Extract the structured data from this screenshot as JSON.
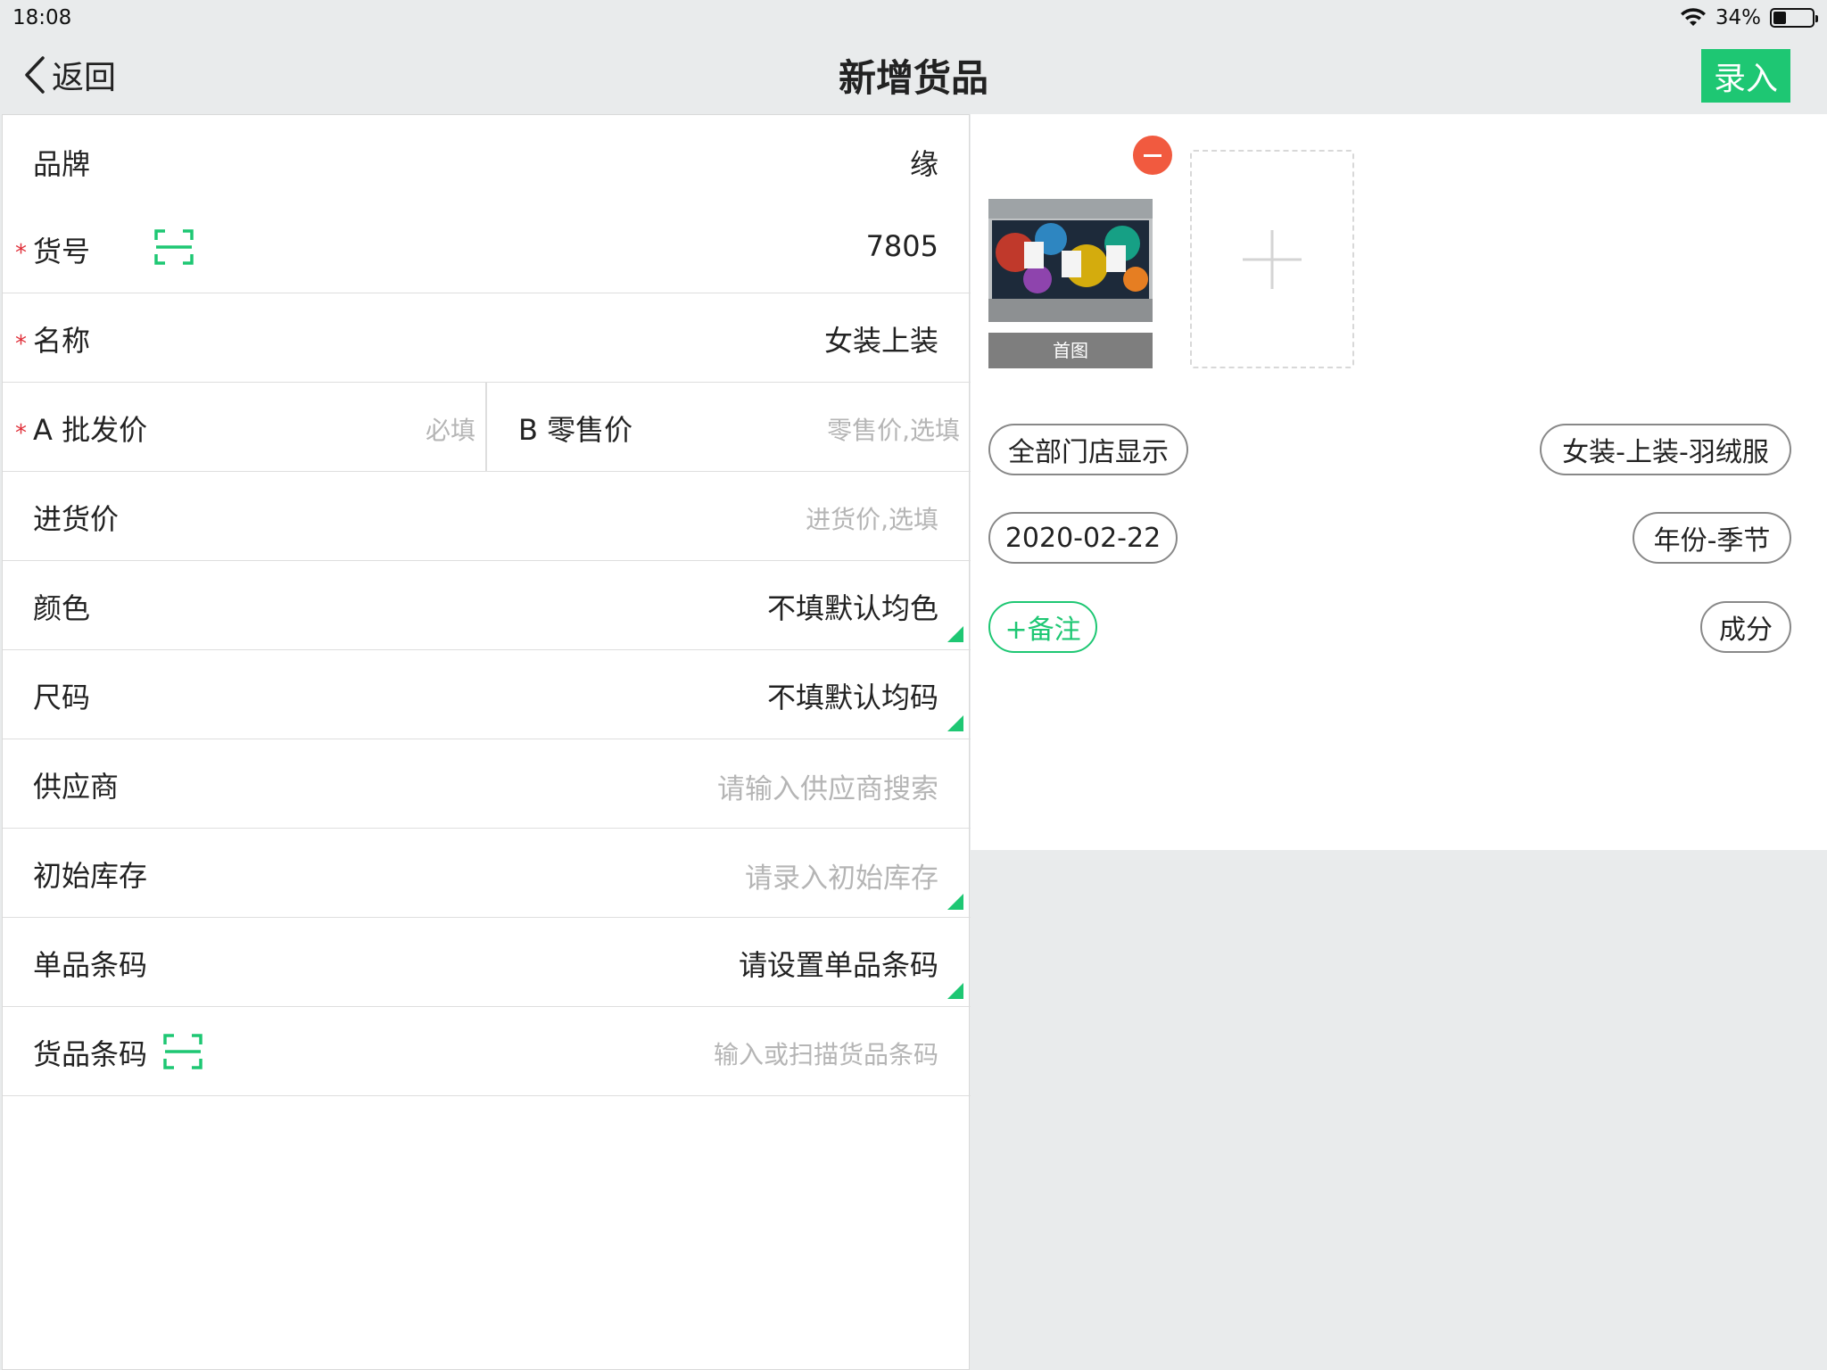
{
  "status_bar": {
    "time": "18:08",
    "battery_percent": "34%",
    "battery_level": 0.34
  },
  "nav": {
    "back_label": "返回",
    "title": "新增货品",
    "submit_label": "录入"
  },
  "form": {
    "brand": {
      "label": "品牌",
      "value": "缘"
    },
    "item_no": {
      "label": "货号",
      "value": "7805",
      "required_mark": "*"
    },
    "name": {
      "label": "名称",
      "value": "女装上装",
      "required_mark": "*"
    },
    "wholesale_price": {
      "label": "A 批发价",
      "placeholder": "必填",
      "required_mark": "*"
    },
    "retail_price": {
      "label": "B 零售价",
      "placeholder": "零售价,选填"
    },
    "purchase_price": {
      "label": "进货价",
      "placeholder": "进货价,选填"
    },
    "color": {
      "label": "颜色",
      "value": "不填默认均色"
    },
    "size": {
      "label": "尺码",
      "value": "不填默认均码"
    },
    "supplier": {
      "label": "供应商",
      "placeholder": "请输入供应商搜索"
    },
    "initial_stock": {
      "label": "初始库存",
      "placeholder": "请录入初始库存"
    },
    "sku_barcode": {
      "label": "单品条码",
      "value": "请设置单品条码"
    },
    "product_barcode": {
      "label": "货品条码",
      "placeholder": "输入或扫描货品条码"
    }
  },
  "media": {
    "thumbnail_label": "首图"
  },
  "tags": {
    "store_display": "全部门店显示",
    "category": "女装-上装-羽绒服",
    "date": "2020-02-22",
    "year_season": "年份-季节",
    "remark": "+备注",
    "composition": "成分"
  },
  "colors": {
    "accent": "#1ec773",
    "danger": "#f15a3f",
    "required": "#e0303a"
  }
}
